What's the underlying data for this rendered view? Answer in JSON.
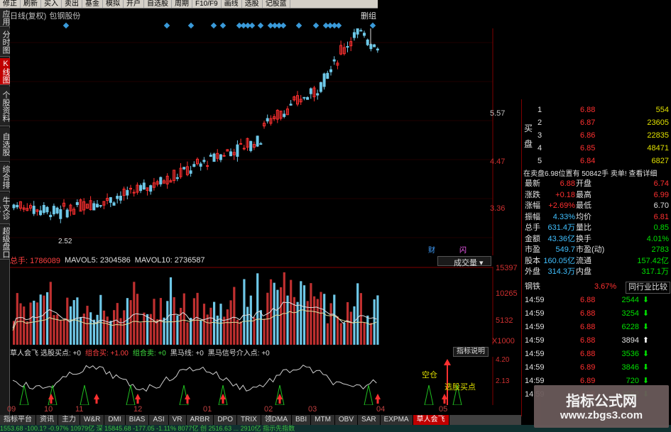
{
  "toolbar": {
    "items": [
      "修正",
      "刷新",
      "买入",
      "卖出",
      "基金",
      "模拟",
      "开户",
      "自选股",
      "周期",
      "F10/F9",
      "画线",
      "选股",
      "记股蓝"
    ]
  },
  "sidebar": {
    "items": [
      "应用",
      "分时图",
      "K线图",
      "个股资料",
      "自选股",
      "综合排名",
      "牛叉诊股",
      "超级盘口"
    ],
    "active_index": 2
  },
  "header": {
    "chart_type": "日线(复权)",
    "stock_name": "包钢股份",
    "right_label": "删组"
  },
  "price_axis": {
    "labels": [
      "5.57",
      "4.47",
      "3.36"
    ],
    "low_marker": "2.52"
  },
  "vol_header": {
    "total": "总手: 1786089",
    "mavol5": "MAVOL5: 2304586",
    "mavol10": "MAVOL10: 2736587",
    "button": "成交量",
    "icons": [
      "财",
      "闪"
    ]
  },
  "vol_axis": {
    "labels": [
      "15397",
      "10265",
      "5132",
      "X1000"
    ]
  },
  "indicator": {
    "name": "草人会飞",
    "items": [
      "选股买点: +0",
      "组合买: +1.00",
      "组合卖: +0",
      "黑马线: +0",
      "黑马信号介入点: +0"
    ],
    "button": "指标说明",
    "axis": [
      "4.20",
      "2.13"
    ],
    "annot_buy": "选股买点",
    "annot_zero": "空仓"
  },
  "months": [
    "09",
    "10",
    "11",
    "12",
    "01",
    "02",
    "03",
    "04",
    "05"
  ],
  "tabs": [
    "指标平台",
    "资讯",
    "主力",
    "W&R",
    "DMI",
    "BIAS",
    "ASI",
    "VR",
    "ARBR",
    "DPO",
    "TRIX",
    "领DMA",
    "BBI",
    "MTM",
    "OBV",
    "SAR",
    "EXPMA",
    "草人会飞"
  ],
  "active_tab": "草人会飞",
  "order_book": {
    "sell_label": "卖盘",
    "buy_label": "买盘",
    "buy": [
      {
        "n": "1",
        "p": "6.88",
        "v": "554"
      },
      {
        "n": "2",
        "p": "6.87",
        "v": "23605"
      },
      {
        "n": "3",
        "p": "6.86",
        "v": "22835"
      },
      {
        "n": "4",
        "p": "6.85",
        "v": "48471"
      },
      {
        "n": "5",
        "p": "6.84",
        "v": "6827"
      }
    ],
    "bar": "在卖盘6.98位置有 50842手 卖单! 查看详细"
  },
  "quote": [
    {
      "l1": "最新",
      "v1": "6.88",
      "l2": "开盘",
      "v2": "6.74"
    },
    {
      "l1": "涨跌",
      "v1": "+0.18",
      "l2": "最高",
      "v2": "6.99"
    },
    {
      "l1": "涨幅",
      "v1": "+2.69%",
      "l2": "最低",
      "v2": "6.70"
    },
    {
      "l1": "振幅",
      "v1": "4.33%",
      "l2": "均价",
      "v2": "6.81"
    },
    {
      "l1": "总手",
      "v1": "631.4万",
      "l2": "量比",
      "v2": "0.85"
    },
    {
      "l1": "金额",
      "v1": "43.36亿",
      "l2": "换手",
      "v2": "4.01%"
    },
    {
      "l1": "市盈",
      "v1": "549.7",
      "l2": "市盈(动)",
      "v2": "2783"
    },
    {
      "l1": "股本",
      "v1": "160.05亿",
      "l2": "流通",
      "v2": "157.42亿"
    },
    {
      "l1": "外盘",
      "v1": "314.3万",
      "l2": "内盘",
      "v2": "317.1万"
    }
  ],
  "industry": {
    "name": "钢铁",
    "change": "3.67%",
    "button": "同行业比较"
  },
  "ticks": [
    {
      "t": "14:59",
      "p": "6.88",
      "v": "2544",
      "d": "down"
    },
    {
      "t": "14:59",
      "p": "6.88",
      "v": "3254",
      "d": "down"
    },
    {
      "t": "14:59",
      "p": "6.88",
      "v": "6228",
      "d": "down"
    },
    {
      "t": "14:59",
      "p": "6.88",
      "v": "3894",
      "d": "up"
    },
    {
      "t": "14:59",
      "p": "6.88",
      "v": "3536",
      "d": "down"
    },
    {
      "t": "14:59",
      "p": "6.89",
      "v": "3846",
      "d": "down"
    },
    {
      "t": "14:59",
      "p": "6.89",
      "v": "720",
      "d": "down"
    },
    {
      "t": "14:59",
      "p": "6.88",
      "v": "3662",
      "d": "down"
    }
  ],
  "watermark": {
    "title": "指标公式网",
    "url": "www.zbgs3.com"
  },
  "statusbar": "1553.68 -100.1? -0.97%  10979亿 深  15845.68 -177.05 -1.11%  8077亿 创  2516.63 ... 2910亿 指示先指数",
  "colors": {
    "up": "#ff3030",
    "down": "#00e000",
    "vol_down": "#6ec8e8",
    "bg": "#000000"
  }
}
